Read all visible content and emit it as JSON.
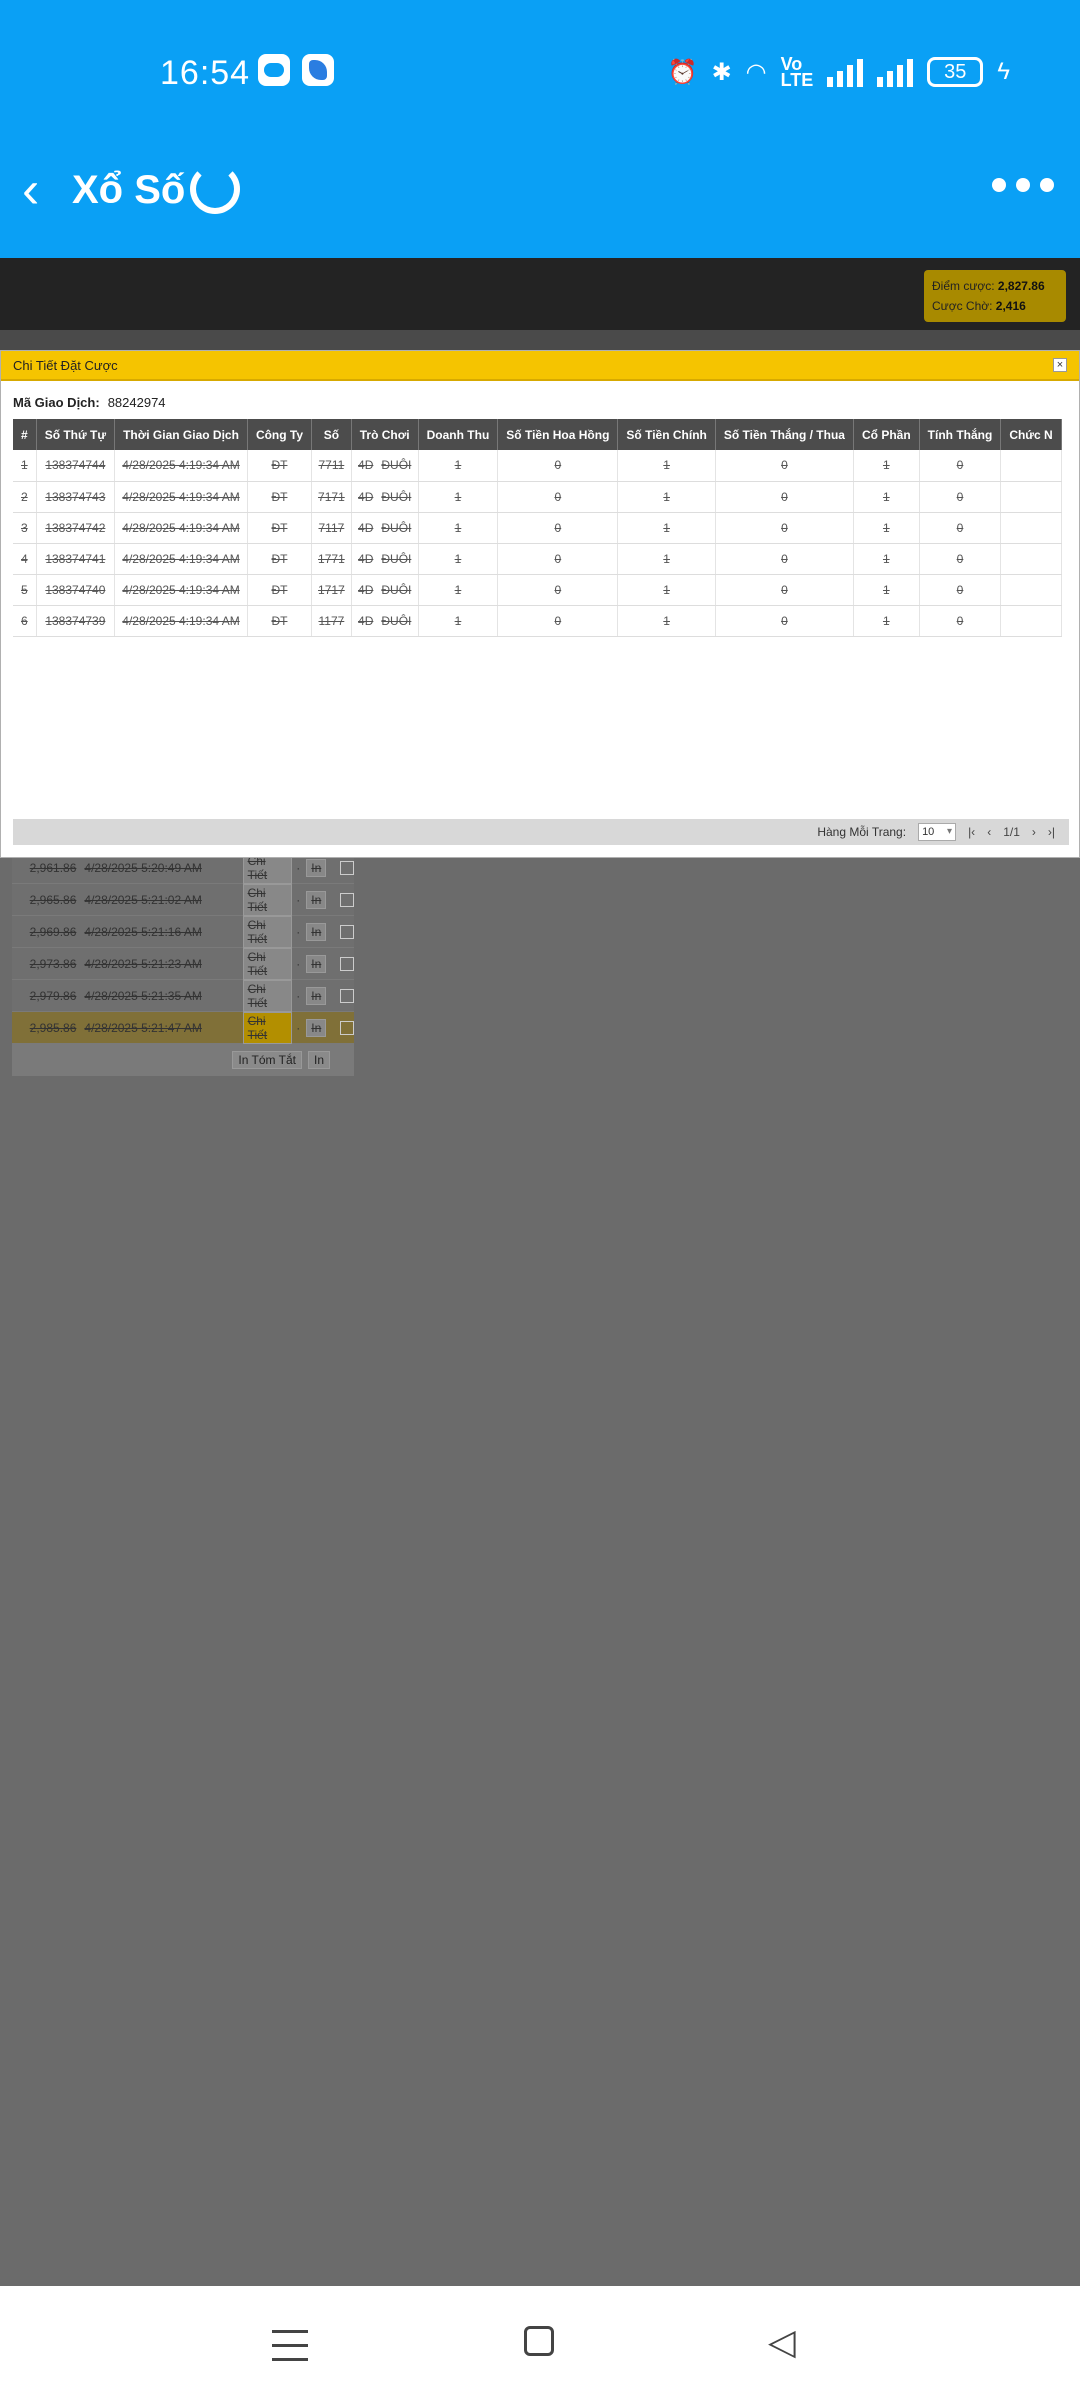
{
  "status_bar": {
    "time": "16:54",
    "network_label": "Vo\nLTE",
    "battery": "35"
  },
  "app_bar": {
    "title": "Xổ Số"
  },
  "balance": {
    "points_label": "Điểm cược:",
    "points_value": "2,827.86",
    "pending_label": "Cược Chờ:",
    "pending_value": "2,416"
  },
  "dialog": {
    "title": "Chi Tiết Đặt Cược",
    "txn_label": "Mã Giao Dịch:",
    "txn_value": "88242974",
    "columns": [
      "#",
      "Số Thứ Tự",
      "Thời Gian Giao Dịch",
      "Công Ty",
      "Số",
      "Trò Chơi",
      "Doanh Thu",
      "Số Tiền Hoa Hồng",
      "Số Tiền Chính",
      "Số Tiền Thắng / Thua",
      "Cổ Phần",
      "Tính Thắng",
      "Chức N"
    ],
    "rows": [
      [
        "1",
        "138374744",
        "4/28/2025 4:19:34 AM",
        "ĐT",
        "7711",
        "4D",
        "ĐUÔI",
        "1",
        "0",
        "1",
        "0",
        "1",
        "0",
        ""
      ],
      [
        "2",
        "138374743",
        "4/28/2025 4:19:34 AM",
        "ĐT",
        "7171",
        "4D",
        "ĐUÔI",
        "1",
        "0",
        "1",
        "0",
        "1",
        "0",
        ""
      ],
      [
        "3",
        "138374742",
        "4/28/2025 4:19:34 AM",
        "ĐT",
        "7117",
        "4D",
        "ĐUÔI",
        "1",
        "0",
        "1",
        "0",
        "1",
        "0",
        ""
      ],
      [
        "4",
        "138374741",
        "4/28/2025 4:19:34 AM",
        "ĐT",
        "1771",
        "4D",
        "ĐUÔI",
        "1",
        "0",
        "1",
        "0",
        "1",
        "0",
        ""
      ],
      [
        "5",
        "138374740",
        "4/28/2025 4:19:34 AM",
        "ĐT",
        "1717",
        "4D",
        "ĐUÔI",
        "1",
        "0",
        "1",
        "0",
        "1",
        "0",
        ""
      ],
      [
        "6",
        "138374739",
        "4/28/2025 4:19:34 AM",
        "ĐT",
        "1177",
        "4D",
        "ĐUÔI",
        "1",
        "0",
        "1",
        "0",
        "1",
        "0",
        ""
      ]
    ],
    "pager": {
      "rows_label": "Hàng Mỗi Trang:",
      "rows_value": "10",
      "page": "1/1"
    }
  },
  "background_list": {
    "rows": [
      {
        "amount": "2,961.86",
        "time": "4/28/2025 5:20:49 AM",
        "highlight": false
      },
      {
        "amount": "2,965.86",
        "time": "4/28/2025 5:21:02 AM",
        "highlight": false
      },
      {
        "amount": "2,969.86",
        "time": "4/28/2025 5:21:16 AM",
        "highlight": false
      },
      {
        "amount": "2,973.86",
        "time": "4/28/2025 5:21:23 AM",
        "highlight": false
      },
      {
        "amount": "2,979.86",
        "time": "4/28/2025 5:21:35 AM",
        "highlight": false
      },
      {
        "amount": "2,985.86",
        "time": "4/28/2025 5:21:47 AM",
        "highlight": true
      }
    ],
    "detail_label": "Chi Tiết",
    "print_label": "In",
    "summary_label": "In Tóm Tắt"
  }
}
